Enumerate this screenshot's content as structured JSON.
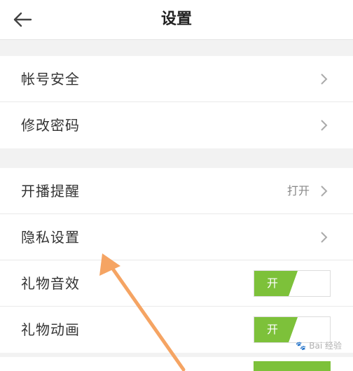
{
  "header": {
    "title": "设置",
    "back_icon": "arrow-left-icon"
  },
  "groups": [
    {
      "items": [
        {
          "label": "帐号安全"
        },
        {
          "label": "修改密码"
        }
      ]
    },
    {
      "items": [
        {
          "label": "开播提醒",
          "value": "打开"
        },
        {
          "label": "隐私设置"
        },
        {
          "label": "礼物音效",
          "toggle_label": "开",
          "toggle_on": true
        },
        {
          "label": "礼物动画",
          "toggle_label": "开",
          "toggle_on": true
        }
      ]
    }
  ],
  "colors": {
    "toggle_on": "#7dc13a",
    "annotation_arrow": "#f5a463"
  },
  "watermark": {
    "text": "Bai 经验"
  }
}
